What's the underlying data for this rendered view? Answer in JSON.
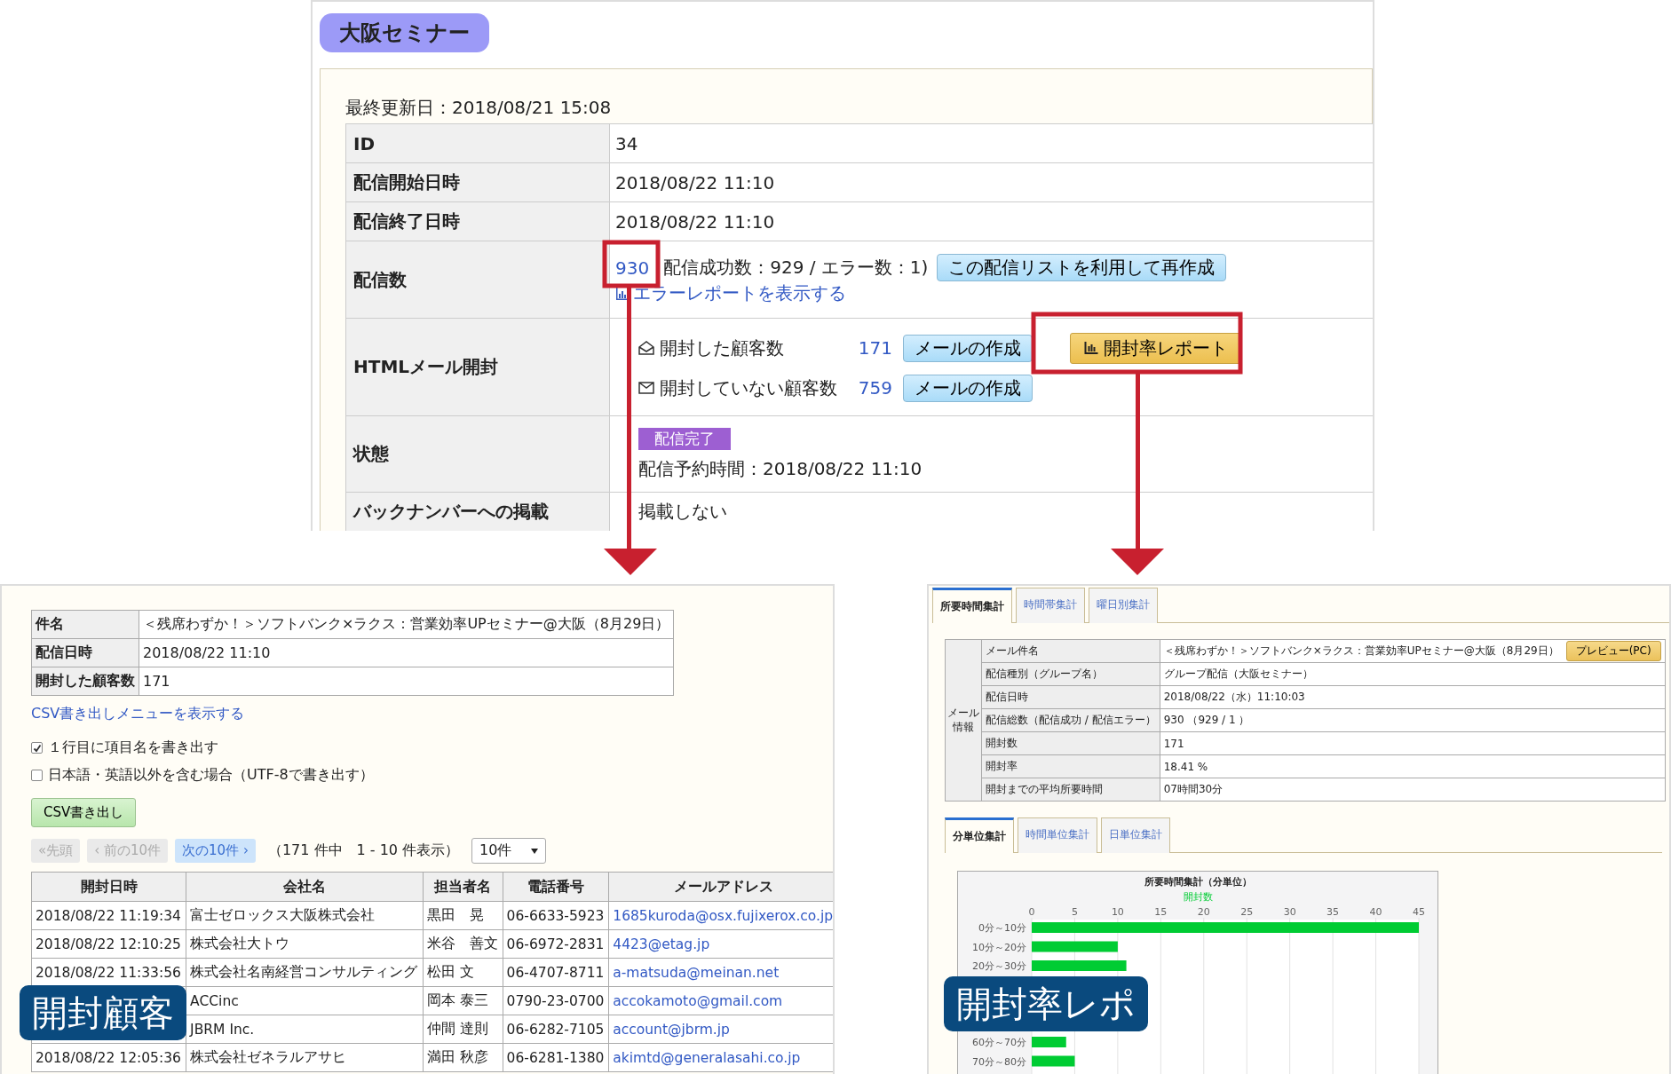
{
  "top_panel": {
    "title": "大阪セミナー",
    "last_updated": "最終更新日：2018/08/21 15:08",
    "rows": [
      {
        "kind": "text",
        "label": "ID",
        "value": "34"
      },
      {
        "kind": "text",
        "label": "配信開始日時",
        "value": "2018/08/22 11:10"
      },
      {
        "kind": "text",
        "label": "配信終了日時",
        "value": "2018/08/22 11:10"
      },
      {
        "kind": "delivery",
        "label": "配信数",
        "count": "930",
        "detail": "配信成功数：929 / エラー数：1)",
        "button": "この配信リストを利用して再作成",
        "link": "エラーレポートを表示する"
      },
      {
        "kind": "opens",
        "label": "HTMLメール開封",
        "lines": [
          {
            "label": "開封した顧客数",
            "count": "171",
            "button": "メールの作成"
          },
          {
            "label": "開封していない顧客数",
            "count": "759",
            "button": "メールの作成"
          }
        ],
        "report_button": "開封率レポート"
      },
      {
        "kind": "status",
        "label": "状態",
        "badge": "配信完了",
        "note": "配信予約時間：2018/08/22 11:10"
      },
      {
        "kind": "text",
        "label": "バックナンバーへの掲載",
        "value": "掲載しない"
      }
    ]
  },
  "customers_panel": {
    "summary": [
      {
        "label": "件名",
        "value": "＜残席わずか！＞ソフトバンク×ラクス：営業効率UPセミナー@大阪（8月29日）"
      },
      {
        "label": "配信日時",
        "value": "2018/08/22 11:10"
      },
      {
        "label": "開封した顧客数",
        "value": "171"
      }
    ],
    "csv_link": "CSV書き出しメニューを表示する",
    "options": [
      {
        "label": "１行目に項目名を書き出す",
        "checked": true
      },
      {
        "label": "日本語・英語以外を含む場合（UTF-8で書き出す）",
        "checked": false
      }
    ],
    "export_button": "CSV書き出し",
    "pager": {
      "buttons": [
        {
          "label": "«先頭",
          "disabled": true
        },
        {
          "label": "‹ 前の10件",
          "disabled": true
        },
        {
          "label": "次の10件 ›",
          "disabled": false
        }
      ],
      "info": "（171 件中　1 - 10 件表示）",
      "page_size": "10件"
    },
    "columns": [
      "開封日時",
      "会社名",
      "担当者名",
      "電話番号",
      "メールアドレス"
    ],
    "rows": [
      {
        "opened_at": "2018/08/22 11:19:34",
        "company": "富士ゼロックス大阪株式会社",
        "contact": "黒田　晃",
        "phone": "06-6633-5923",
        "email": "1685kuroda@osx.fujixerox.co.jp"
      },
      {
        "opened_at": "2018/08/22 12:10:25",
        "company": "株式会社大トウ",
        "contact": "米谷　善文",
        "phone": "06-6972-2831",
        "email": "4423@etag.jp"
      },
      {
        "opened_at": "2018/08/22 11:33:56",
        "company": "株式会社名南経営コンサルティング",
        "contact": "松田 文",
        "phone": "06-4707-8711",
        "email": "a-matsuda@meinan.net"
      },
      {
        "company": "ACCinc",
        "contact": "岡本 泰三",
        "phone": "0790-23-0700",
        "email": "accokamoto@gmail.com"
      },
      {
        "company": "JBRM Inc.",
        "contact": "仲間 達則",
        "phone": "06-6282-7105",
        "email": "account@jbrm.jp"
      },
      {
        "opened_at": "2018/08/22 12:05:36",
        "company": "株式会社ゼネラルアサヒ",
        "contact": "満田 秋彦",
        "phone": "06-6281-1380",
        "email": "akimtd@generalasahi.co.jp"
      }
    ]
  },
  "report_panel": {
    "tabs": [
      {
        "label": "所要時間集計",
        "selected": true
      },
      {
        "label": "時間帯集計",
        "selected": false
      },
      {
        "label": "曜日別集計",
        "selected": false
      }
    ],
    "info_group": "メール情報",
    "info_rows": [
      {
        "label": "メール件名",
        "value": "＜残席わずか！＞ソフトバンク×ラクス：営業効率UPセミナー@大阪（8月29日）",
        "button": "プレビュー(PC)"
      },
      {
        "label": "配信種別（グループ名）",
        "value": "グループ配信（大阪セミナー）"
      },
      {
        "label": "配信日時",
        "value": "2018/08/22（水）11:10:03"
      },
      {
        "label": "配信総数（配信成功 / 配信エラー）",
        "value": "930 （929 / 1 ）"
      },
      {
        "label": "開封数",
        "value": "171"
      },
      {
        "label": "開封率",
        "value": "18.41 %"
      },
      {
        "label": "開封までの平均所要時間",
        "value": "07時間30分"
      }
    ],
    "subtabs": [
      {
        "label": "分単位集計",
        "selected": true
      },
      {
        "label": "時間単位集計",
        "selected": false
      },
      {
        "label": "日単位集計",
        "selected": false
      }
    ],
    "chart_data": {
      "type": "bar",
      "orientation": "horizontal",
      "grid": true,
      "title": "所要時間集計（分単位）",
      "xticks": [
        0,
        5,
        10,
        15,
        20,
        25,
        30,
        35,
        40,
        45
      ],
      "xlim": [
        0,
        45
      ],
      "categories": [
        "0分～10分",
        "10分～20分",
        "20分～30分",
        null,
        null,
        null,
        "60分～70分",
        "70分～80分"
      ],
      "series": [
        {
          "name": "開封数",
          "color": "#00cc33",
          "values": [
            45,
            10,
            11,
            null,
            null,
            null,
            4,
            5
          ]
        }
      ]
    }
  },
  "callouts": [
    {
      "label": "開封顧客"
    },
    {
      "label": "開封率レポ"
    }
  ]
}
